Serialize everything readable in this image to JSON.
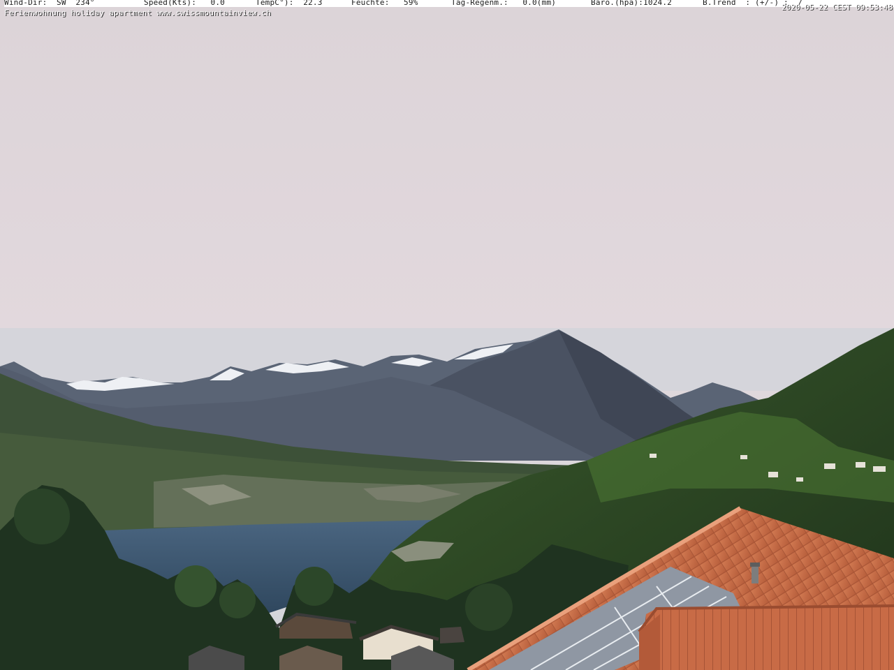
{
  "weather_bar": {
    "wind_dir": "Wind-Dir:  SW  234°",
    "speed": "Speed(Kts):   0.0",
    "temp": "TempC°):  22.3",
    "humidity": "Feuchte:   59%",
    "rain": "Tag-Regenm.:   0.0(mm)",
    "baro": "Baro.(hpa):1024.2",
    "trend": "B.Trend  : (+/-) :  /"
  },
  "caption": "Ferienwohnung holiday apartment www.swissmountainview.ch",
  "timestamp": "2020-05-22 CEST 09:53:48",
  "colors": {
    "sky_top": "#dcd2d8",
    "sky_bottom": "#d3d5d9",
    "mountains": "#4c5566",
    "lake": "#3b5670",
    "forest": "#263a22",
    "roof": "#c66a45"
  }
}
